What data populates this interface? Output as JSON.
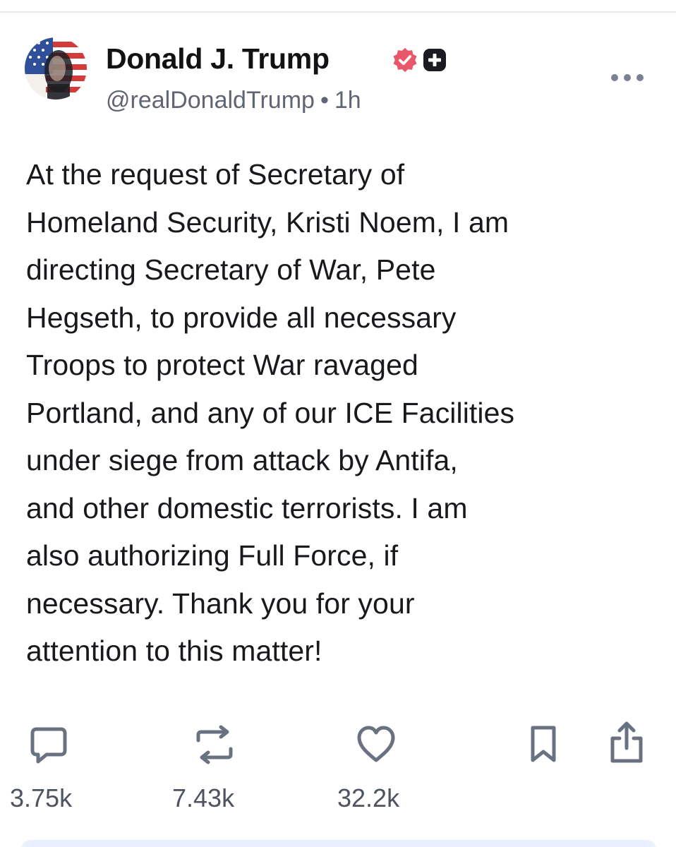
{
  "post": {
    "display_name": "Donald J. Trump",
    "handle": "@realDonaldTrump",
    "separator": "•",
    "time_ago": "1h",
    "text_lines": [
      "At the request of Secretary of",
      "Homeland Security, Kristi Noem, I am",
      "directing Secretary of War, Pete",
      "Hegseth, to provide all necessary",
      "Troops to protect War ravaged",
      "Portland, and any of our ICE Facilities",
      "under siege from attack by Antifa,",
      "and other domestic terrorists. I am",
      "also authorizing Full Force, if",
      "necessary. Thank you for your",
      "attention to this matter!"
    ]
  },
  "actions": {
    "replies": "3.75k",
    "reposts": "7.43k",
    "likes": "32.2k"
  },
  "icons": {
    "verified": "verified-badge-icon",
    "plus": "plus-badge-icon",
    "more": "more-options-icon",
    "reply": "reply-icon",
    "repost": "repost-icon",
    "like": "heart-icon",
    "bookmark": "bookmark-icon",
    "share": "share-icon"
  },
  "colors": {
    "verified_badge": "#e9576b",
    "text": "#18191c",
    "muted": "#5e6673",
    "icon": "#6a7180"
  }
}
